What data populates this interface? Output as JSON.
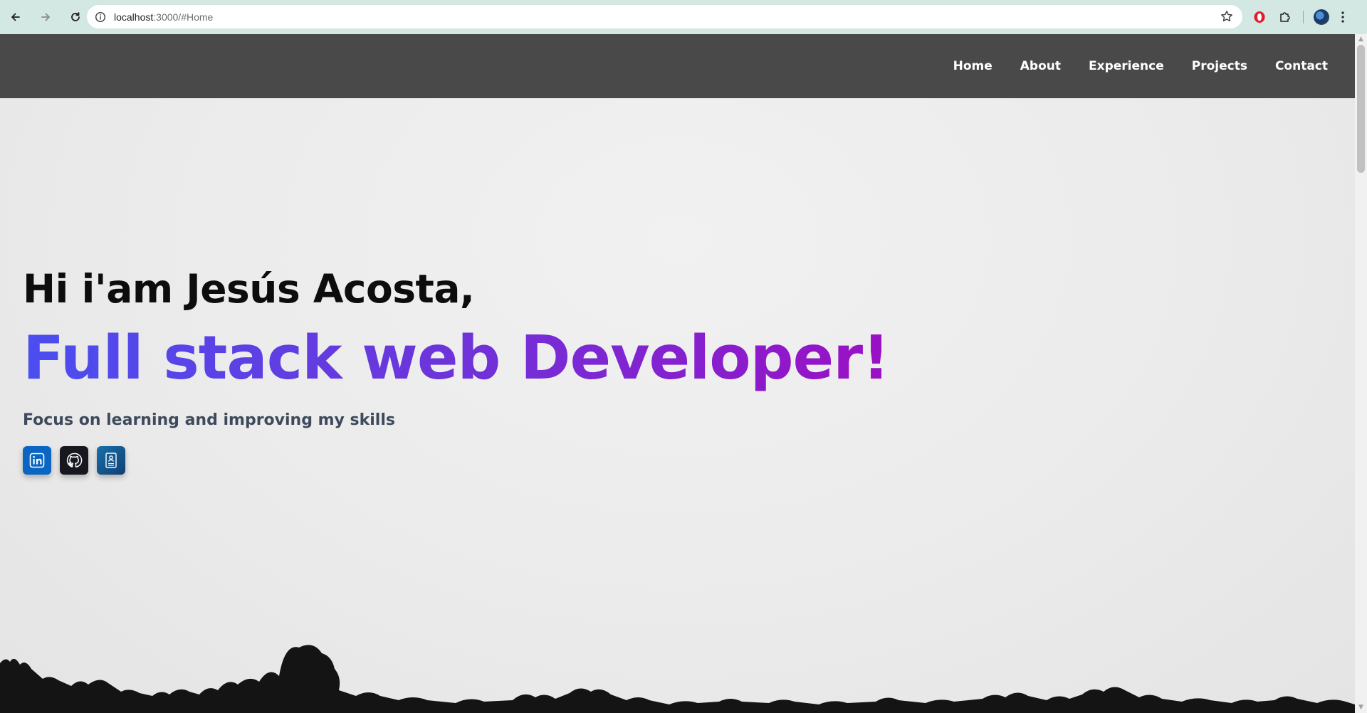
{
  "browser": {
    "url_host": "localhost",
    "url_rest": ":3000/#Home",
    "icons": {
      "back": "arrow-left-icon",
      "forward": "arrow-right-icon",
      "reload": "reload-icon",
      "info": "info-icon",
      "bookmark": "star-icon",
      "opera": "opera-icon",
      "extensions": "puzzle-icon",
      "profile": "avatar",
      "menu": "kebab-menu-icon"
    }
  },
  "nav": {
    "items": [
      {
        "label": "Home"
      },
      {
        "label": "About"
      },
      {
        "label": "Experience"
      },
      {
        "label": "Projects"
      },
      {
        "label": "Contact"
      }
    ]
  },
  "hero": {
    "greeting": "Hi i'am Jesús Acosta,",
    "role": "Full stack web Developer!",
    "tagline": "Focus on learning and improving my skills",
    "social": [
      {
        "icon": "linkedin-icon"
      },
      {
        "icon": "github-icon"
      },
      {
        "icon": "resume-icon"
      }
    ]
  },
  "colors": {
    "navbar": "#494949",
    "gradient_start": "#4b4ef0",
    "gradient_end": "#9a10c4",
    "linkedin": "#0a66c2",
    "github": "#17171f"
  }
}
